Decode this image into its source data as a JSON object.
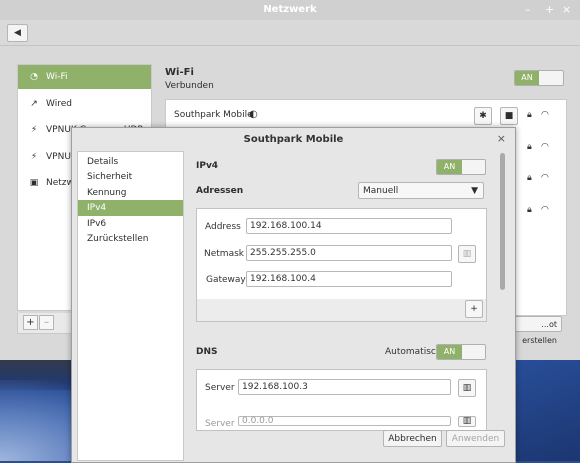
{
  "window": {
    "title": "Netzwerk",
    "minimize": "–",
    "maximize": "+",
    "close": "×",
    "back_icon": "back-arrow-icon"
  },
  "sidebar": {
    "items": [
      {
        "label": "Wi-Fi",
        "icon": "wifi-icon"
      },
      {
        "label": "Wired",
        "icon": "wired-icon"
      },
      {
        "label": "VPNUK-Germany-UDP",
        "icon": "vpn-icon"
      },
      {
        "label": "VPNUK",
        "icon": "vpn-icon"
      },
      {
        "label": "Netzwerk-Proxy",
        "icon": "proxy-icon"
      }
    ],
    "add": "+",
    "remove": "–"
  },
  "wifi": {
    "title": "Wi-Fi",
    "status": "Verbunden",
    "toggle": "AN",
    "network": "Southpark Mobile",
    "hotspot_label": "...ot erstellen"
  },
  "dialog": {
    "title": "Southpark Mobile",
    "close": "×",
    "tabs": [
      "Details",
      "Sicherheit",
      "Kennung",
      "IPv4",
      "IPv6",
      "Zurückstellen"
    ],
    "ipv4": {
      "heading": "IPv4",
      "toggle": "AN"
    },
    "addresses": {
      "label": "Adressen",
      "method": "Manuell"
    },
    "address": {
      "label": "Address",
      "value": "192.168.100.14"
    },
    "netmask": {
      "label": "Netmask",
      "value": "255.255.255.0"
    },
    "gateway": {
      "label": "Gateway",
      "value": "192.168.100.4"
    },
    "add": "+",
    "dns": {
      "heading": "DNS",
      "auto_label": "Automatisch",
      "toggle": "AN",
      "server_label": "Server",
      "server_value": "192.168.100.3",
      "server2_label": "Server",
      "server2_value": "0.0.0.0"
    },
    "cancel": "Abbrechen",
    "apply": "Anwenden"
  }
}
